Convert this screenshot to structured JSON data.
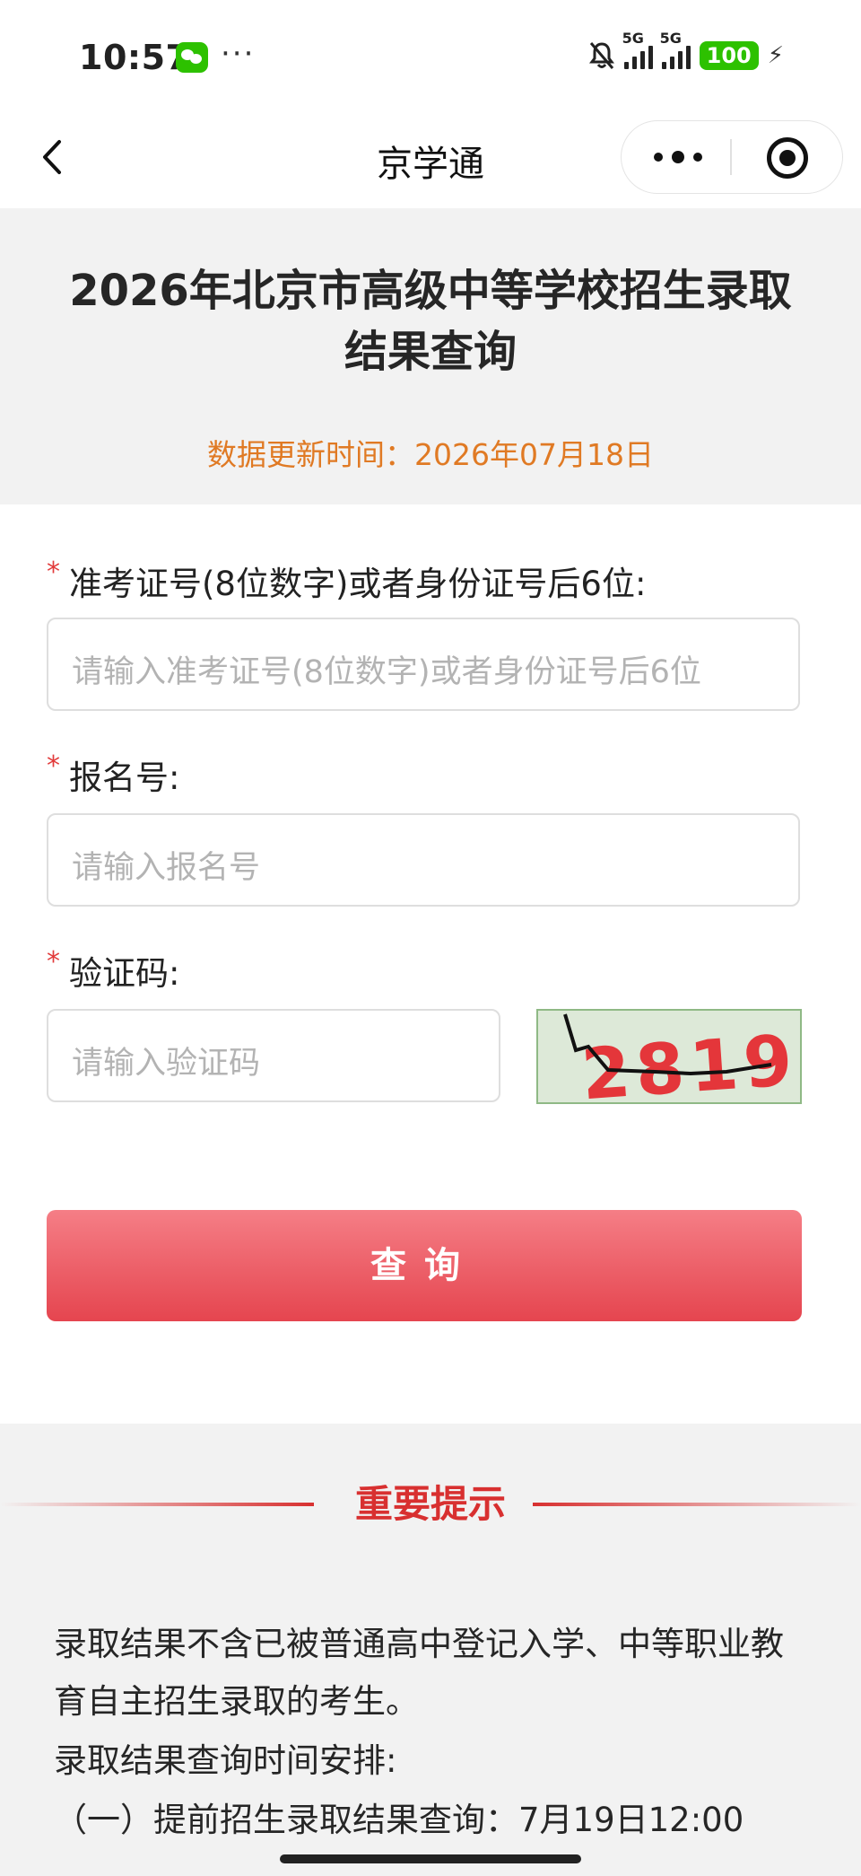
{
  "status_bar": {
    "time": "10:57",
    "dots": "···",
    "network": "5G",
    "battery": "100"
  },
  "nav": {
    "title": "京学通"
  },
  "header": {
    "title": "2026年北京市高级中等学校招生录取结果查询",
    "update": "数据更新时间：2026年07月18日"
  },
  "form": {
    "exam_id": {
      "label": "准考证号(8位数字)或者身份证号后6位:",
      "placeholder": "请输入准考证号(8位数字)或者身份证号后6位"
    },
    "reg_no": {
      "label": "报名号:",
      "placeholder": "请输入报名号"
    },
    "captcha": {
      "label": "验证码:",
      "placeholder": "请输入验证码",
      "code": "2819"
    },
    "required_mark": "*",
    "submit": "查询"
  },
  "tips": {
    "title": "重要提示",
    "paragraph1": "录取结果不含已被普通高中登记入学、中等职业教育自主招生录取的考生。",
    "paragraph2": "录取结果查询时间安排:",
    "item1": "（一）提前招生录取结果查询：7月19日12:00"
  },
  "colors": {
    "accent_red": "#d83030",
    "update_orange": "#e07a24",
    "button_top": "#f57e86",
    "button_bottom": "#e5454f"
  }
}
